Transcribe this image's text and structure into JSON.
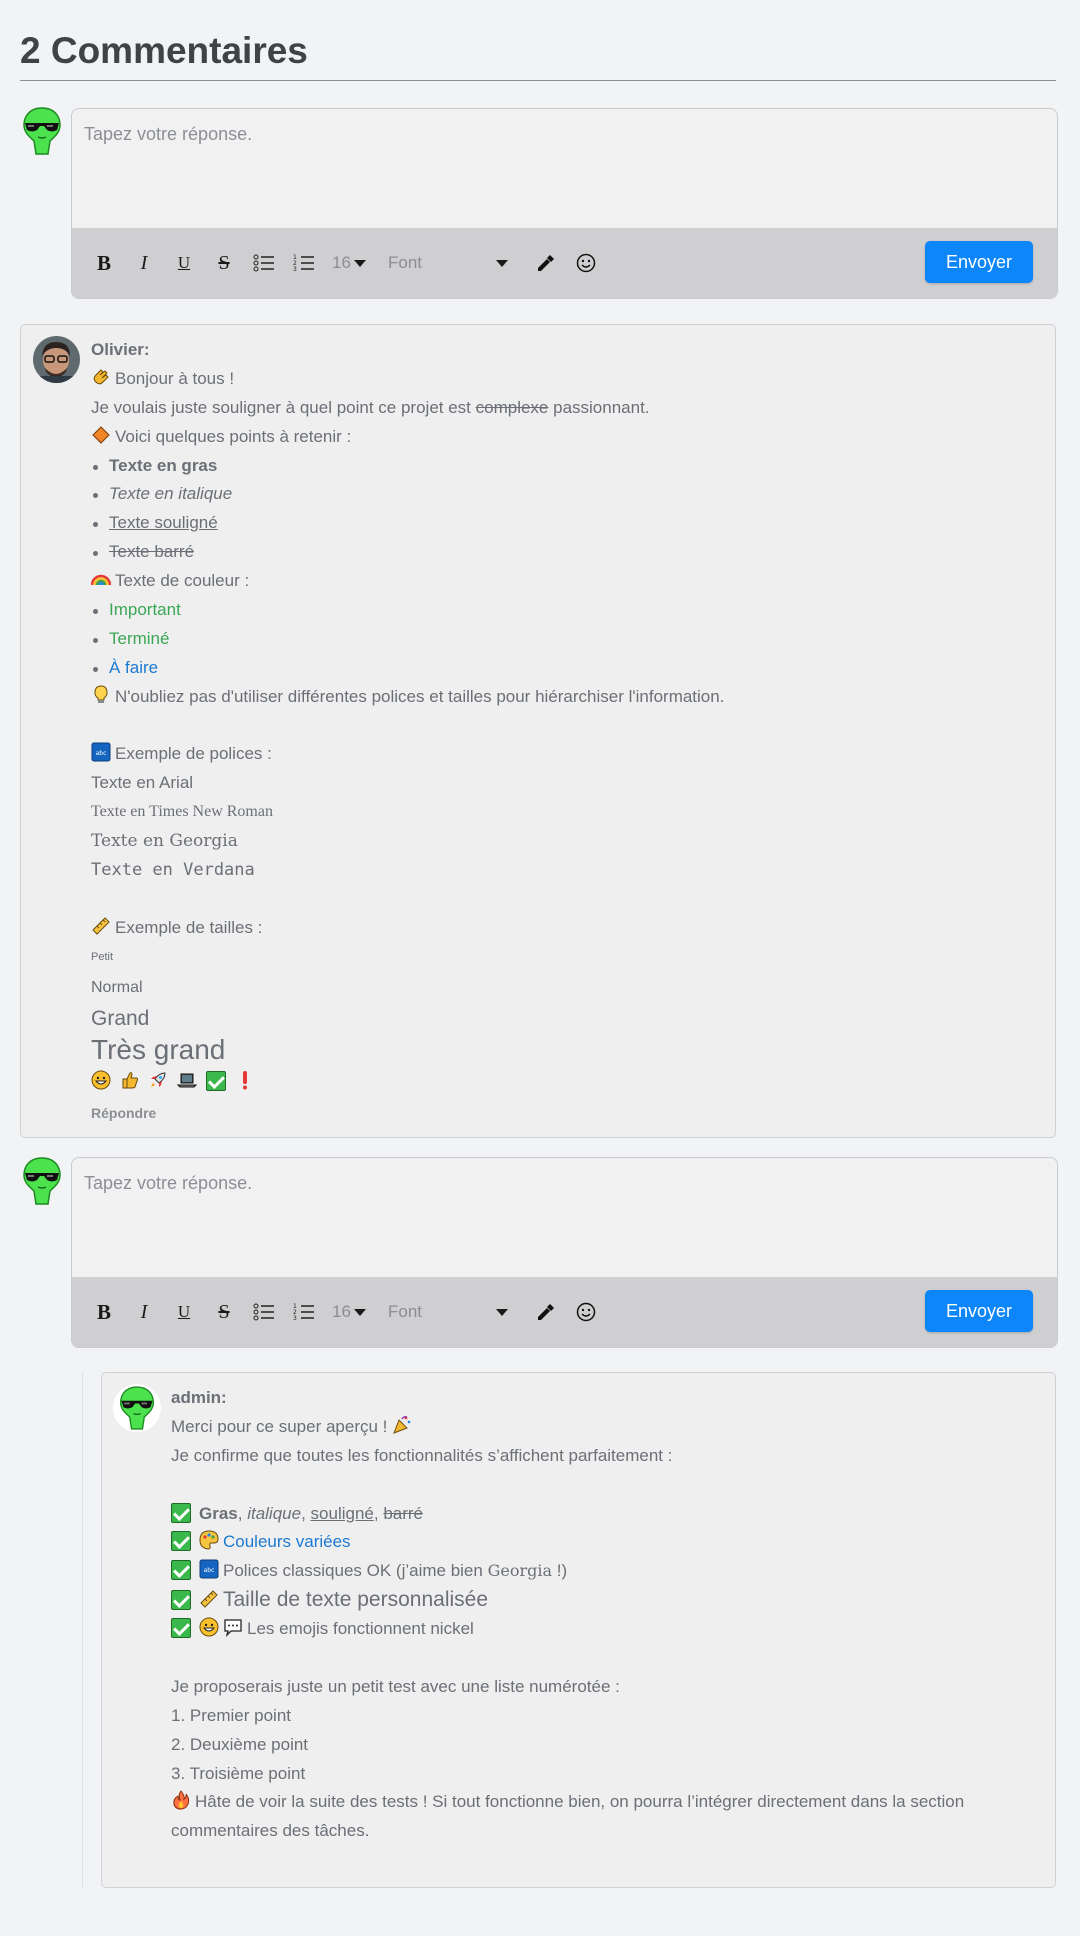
{
  "header": {
    "title": "2 Commentaires"
  },
  "editor": {
    "placeholder": "Tapez votre réponse.",
    "font_size": "16",
    "font_label": "Font",
    "send_label": "Envoyer"
  },
  "comment1": {
    "author": "Olivier:",
    "lines": {
      "greeting": "Bonjour à tous !",
      "intro_a": "Je voulais juste souligner à quel point ce projet est ",
      "intro_strike": "complexe",
      "intro_b": " passionnant.",
      "points": "Voici quelques points à retenir :",
      "bold": "Texte en gras",
      "italic": "Texte en italique",
      "underline": "Texte souligné",
      "strike": "Texte barré",
      "color_title": "Texte de couleur :",
      "important": "Important",
      "termine": "Terminé",
      "afaire": "À faire",
      "tip": "N'oubliez pas d'utiliser différentes polices et tailles pour hiérarchiser l'information.",
      "fonts_title": "Exemple de polices :",
      "arial": "Texte en Arial",
      "times": "Texte en Times New Roman",
      "georgia": "Texte en Georgia",
      "verdana": "Texte en Verdana",
      "sizes_title": "Exemple de tailles :",
      "petit": "Petit",
      "normal": "Normal",
      "grand": "Grand",
      "tres_grand": "Très grand"
    },
    "reply_label": "Répondre"
  },
  "comment2": {
    "author": "admin:",
    "lines": {
      "thanks": "Merci pour ce super aperçu !",
      "confirm": "Je confirme que toutes les fonctionnalités s’affichent parfaitement :",
      "gras": "Gras",
      "sep1": ", ",
      "italique": "italique",
      "sep2": ", ",
      "souligne": "souligné",
      "sep3": ", ",
      "barre": "barré",
      "couleurs": "Couleurs variées",
      "polices": "Polices classiques OK (j’aime bien ",
      "georgia_word": "Georgia",
      "polices_end": " !)",
      "taille": "Taille de texte personnalisée",
      "emojis": "Les emojis fonctionnent nickel",
      "propose": "Je proposerais juste un petit test avec une liste numérotée :",
      "p1": "1. Premier point",
      "p2": "2. Deuxième point",
      "p3": "3. Troisième point",
      "hate_1": "Hâte de voir la suite des tests ! Si tout fonctionne bien, on pourra l’intégrer directement dans la section",
      "hate_2": "commentaires des tâches."
    }
  },
  "colors": {
    "accent": "#0d86f9",
    "green": "#3aa755",
    "blue": "#1e7ad0"
  }
}
